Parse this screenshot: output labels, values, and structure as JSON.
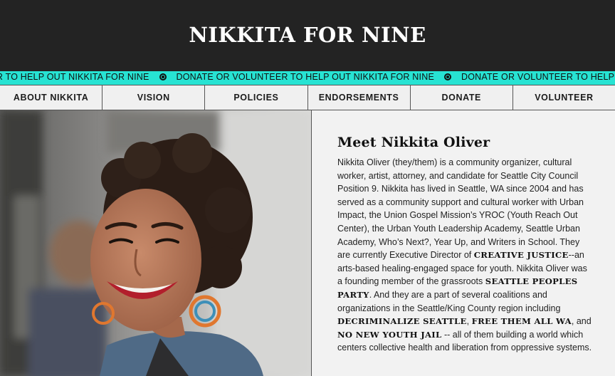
{
  "header": {
    "title": "NIKKITA FOR NINE"
  },
  "ticker": {
    "items": [
      "TEER TO HELP OUT NIKKITA FOR NINE",
      "DONATE OR VOLUNTEER TO HELP OUT NIKKITA FOR NINE",
      "DONATE OR VOLUNTEER TO HELP OUT NIKKITA FOR NINE"
    ]
  },
  "nav": {
    "items": [
      "ABOUT NIKKITA",
      "VISION",
      "POLICIES",
      "ENDORSEMENTS",
      "DONATE",
      "VOLUNTEER"
    ]
  },
  "photo": {
    "alt": ""
  },
  "bio": {
    "heading": "Meet Nikkita Oliver",
    "p1": "Nikkita Oliver (they/them) is a community organizer, cultural worker, artist, attorney, and candidate for Seattle City Council Position 9. Nikkita has lived in Seattle, WA since 2004 and has served as a community support and cultural worker with Urban Impact, the Union Gospel Mission’s YROC (Youth Reach Out Center), the Urban Youth Leadership Academy, Seattle Urban Academy, Who’s Next?, Year Up, and Writers in School. They are currently Executive Director of ",
    "link1": "CREATIVE JUSTICE",
    "p2": "--an arts-based healing-engaged space for youth. Nikkita Oliver was a founding member of the grassroots ",
    "link2": "SEATTLE PEOPLES PARTY",
    "p3": ". And they are a part of several coalitions and organizations in the Seattle/King County region including ",
    "link3": "DECRIMINALIZE SEATTLE",
    "sep1": ", ",
    "link4": "FREE THEM ALL WA",
    "sep2": ", and ",
    "link5": "NO NEW YOUTH JAIL",
    "p4": " -- all of them building a world which centers collective health and liberation from oppressive systems."
  }
}
